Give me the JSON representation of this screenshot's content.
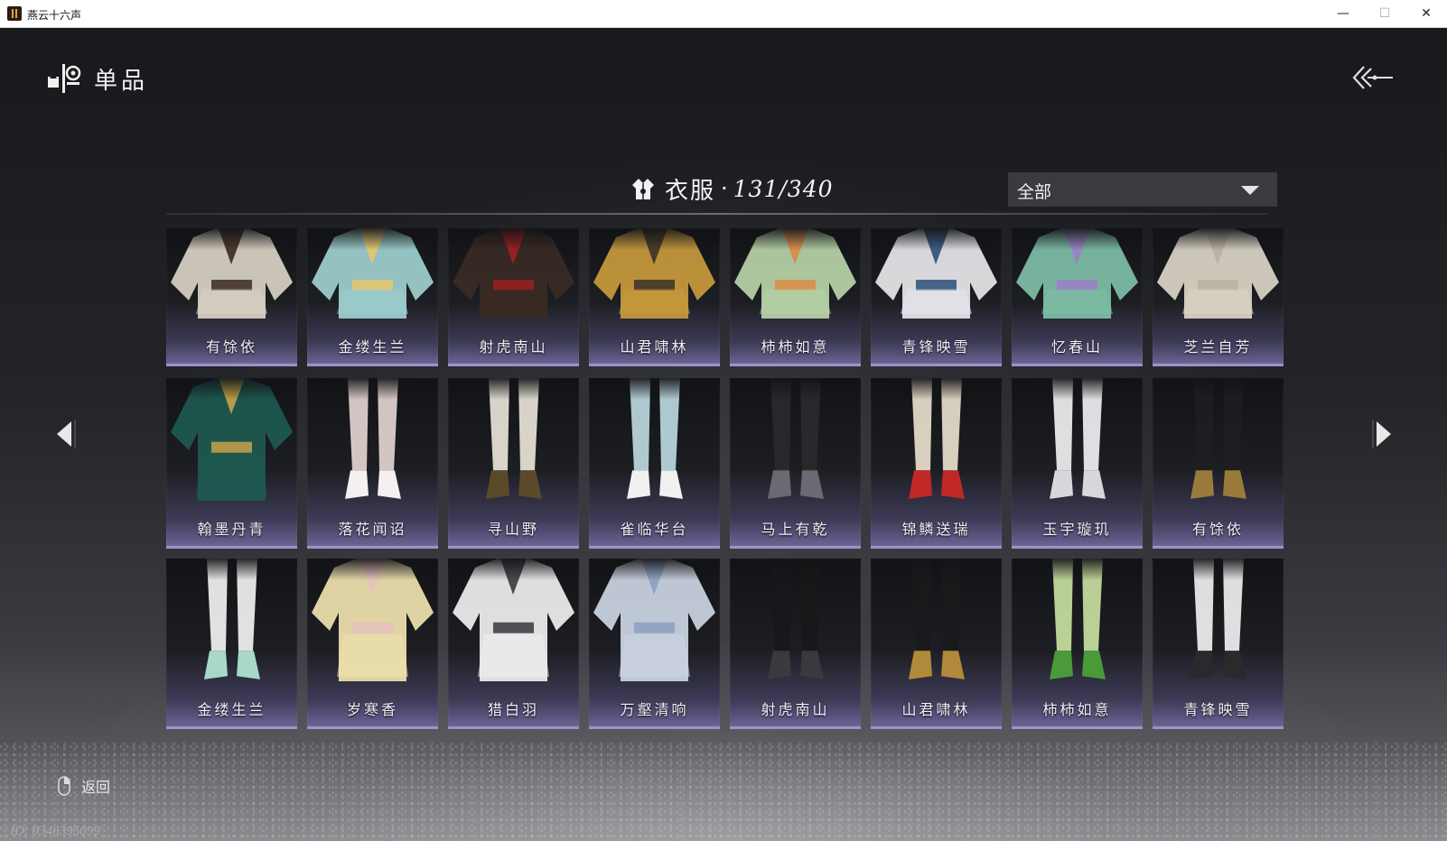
{
  "window": {
    "title": "燕云十六声",
    "minimize": "—",
    "maximize": "☐",
    "close": "✕"
  },
  "header": {
    "title": "单品",
    "icon": "wardrobe-items-icon",
    "back_icon": "back-arrows-icon"
  },
  "category": {
    "icon": "clothing-icon",
    "name": "衣服",
    "separator": "·",
    "count": "131/340"
  },
  "filter": {
    "selected": "全部"
  },
  "items": [
    [
      {
        "name": "有馀依",
        "colors": [
          "#d9d3c6",
          "#3a2a20"
        ]
      },
      {
        "name": "金缕生兰",
        "colors": [
          "#9fd0cf",
          "#e8c76a"
        ]
      },
      {
        "name": "射虎南山",
        "colors": [
          "#3a2a24",
          "#9c2020"
        ]
      },
      {
        "name": "山君啸林",
        "colors": [
          "#c99a3c",
          "#3a332c"
        ]
      },
      {
        "name": "柿柿如意",
        "colors": [
          "#b9d4a8",
          "#d98b45"
        ]
      },
      {
        "name": "青锋映雪",
        "colors": [
          "#e8e8ec",
          "#2c4f7a"
        ]
      },
      {
        "name": "忆春山",
        "colors": [
          "#7fbfa8",
          "#9b7fc7"
        ]
      },
      {
        "name": "芝兰自芳",
        "colors": [
          "#dcd6c8",
          "#b8b0a0"
        ]
      }
    ],
    [
      {
        "name": "翰墨丹青",
        "colors": [
          "#1d5a50",
          "#c9a24a"
        ]
      },
      {
        "name": "落花闻诏",
        "colors": [
          "#e3d4d0",
          "#f4f0f0"
        ]
      },
      {
        "name": "寻山野",
        "colors": [
          "#e8e4d8",
          "#5a4a2a"
        ]
      },
      {
        "name": "雀临华台",
        "colors": [
          "#bcd8e0",
          "#f0f0f0"
        ]
      },
      {
        "name": "马上有乾",
        "colors": [
          "#2a2a2e",
          "#6a6a72"
        ]
      },
      {
        "name": "锦鳞送瑞",
        "colors": [
          "#e8e0cc",
          "#c02828"
        ]
      },
      {
        "name": "玉宇璇玑",
        "colors": [
          "#f0f0f2",
          "#d8d8dc"
        ]
      },
      {
        "name": "有馀依",
        "colors": [
          "#1e1e22",
          "#9a7a3a"
        ]
      }
    ],
    [
      {
        "name": "金缕生兰",
        "colors": [
          "#f2f2f0",
          "#a8d8c8"
        ]
      },
      {
        "name": "岁寒香",
        "colors": [
          "#f0e3b0",
          "#e8c0c0"
        ]
      },
      {
        "name": "猎白羽",
        "colors": [
          "#f0f0f0",
          "#3a3a3e"
        ]
      },
      {
        "name": "万壑清响",
        "colors": [
          "#cdd6e4",
          "#8aa0c0"
        ]
      },
      {
        "name": "射虎南山",
        "colors": [
          "#18181a",
          "#3a3a3e"
        ]
      },
      {
        "name": "山君啸林",
        "colors": [
          "#1a1a1c",
          "#b08a3a"
        ]
      },
      {
        "name": "柿柿如意",
        "colors": [
          "#c8e0a0",
          "#4a9a3a"
        ]
      },
      {
        "name": "青锋映雪",
        "colors": [
          "#f0f0f0",
          "#2a2a2c"
        ]
      }
    ]
  ],
  "footer": {
    "back_label": "返回",
    "mouse_icon": "mouse-right-click-icon",
    "player_id": "ID: 0346395099"
  },
  "nav": {
    "prev_icon": "arrow-left-icon",
    "next_icon": "arrow-right-icon"
  }
}
